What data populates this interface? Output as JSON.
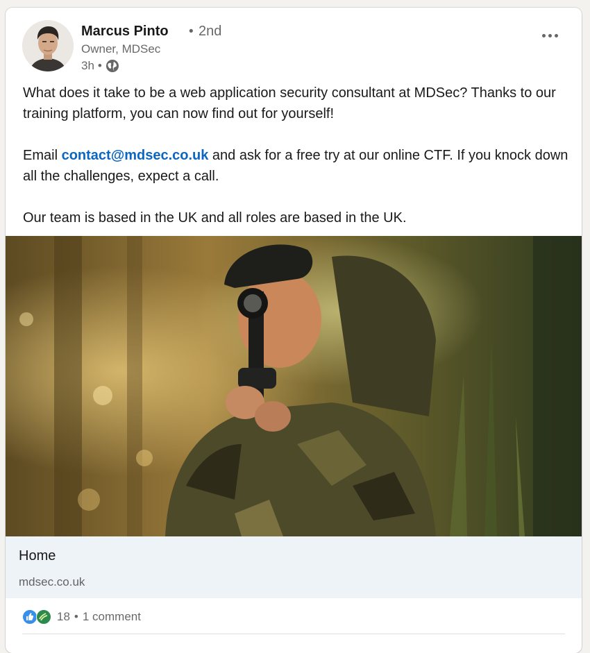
{
  "author": {
    "name": "Marcus Pinto",
    "degree_separator": "•",
    "degree": "2nd",
    "headline": "Owner, MDSec",
    "time": "3h",
    "time_separator": "•",
    "visibility_icon": "globe-icon"
  },
  "menu": {
    "icon": "more-options-icon"
  },
  "post": {
    "paragraph1": "What does it take to be a web application security consultant at MDSec? Thanks to our training platform, you can now find out for yourself!",
    "paragraph2_prefix": "Email ",
    "paragraph2_link": "contact@mdsec.co.uk",
    "paragraph2_suffix": " and ask for a free try at our online CTF. If you knock down all the challenges, expect a call.",
    "paragraph3": "Our team is based in the UK and all roles are based in the UK."
  },
  "link_preview": {
    "title": "Home",
    "domain": "mdsec.co.uk"
  },
  "social": {
    "reactions": [
      "like-icon",
      "support-icon"
    ],
    "reaction_count": "18",
    "separator": "•",
    "comments": "1 comment"
  },
  "colors": {
    "link": "#0a66c2",
    "preview_bg": "#eef3f8",
    "like": "#378fe9",
    "support": "#2d8a4e"
  }
}
